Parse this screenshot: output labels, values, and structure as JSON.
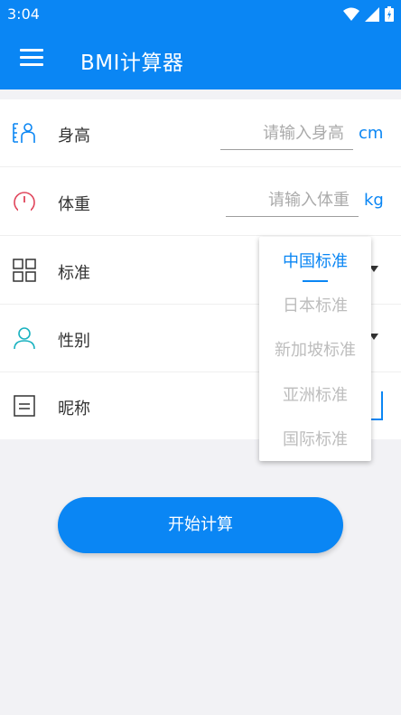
{
  "status_bar": {
    "time": "3:04"
  },
  "app_bar": {
    "title": "BMI计算器"
  },
  "form": {
    "height": {
      "label": "身高",
      "placeholder": "请输入身高",
      "unit": "cm"
    },
    "weight": {
      "label": "体重",
      "placeholder": "请输入体重",
      "unit": "kg"
    },
    "standard": {
      "label": "标准"
    },
    "gender": {
      "label": "性别"
    },
    "nickname": {
      "label": "昵称"
    }
  },
  "standard_dropdown": {
    "options": [
      "中国标准",
      "日本标准",
      "新加坡标准",
      "亚洲标准",
      "国际标准"
    ],
    "selected_index": 0
  },
  "start_button": {
    "label": "开始计算"
  },
  "colors": {
    "primary": "#0a86f4",
    "placeholder": "#aaaaaa",
    "unselected_option": "#bdbdbd",
    "weight_icon": "#e0445a",
    "gender_icon": "#1ab2c0"
  },
  "icons": {
    "height": "person-height-icon",
    "weight": "scale-gauge-icon",
    "standard": "grid-icon",
    "gender": "person-icon",
    "nickname": "note-icon"
  }
}
